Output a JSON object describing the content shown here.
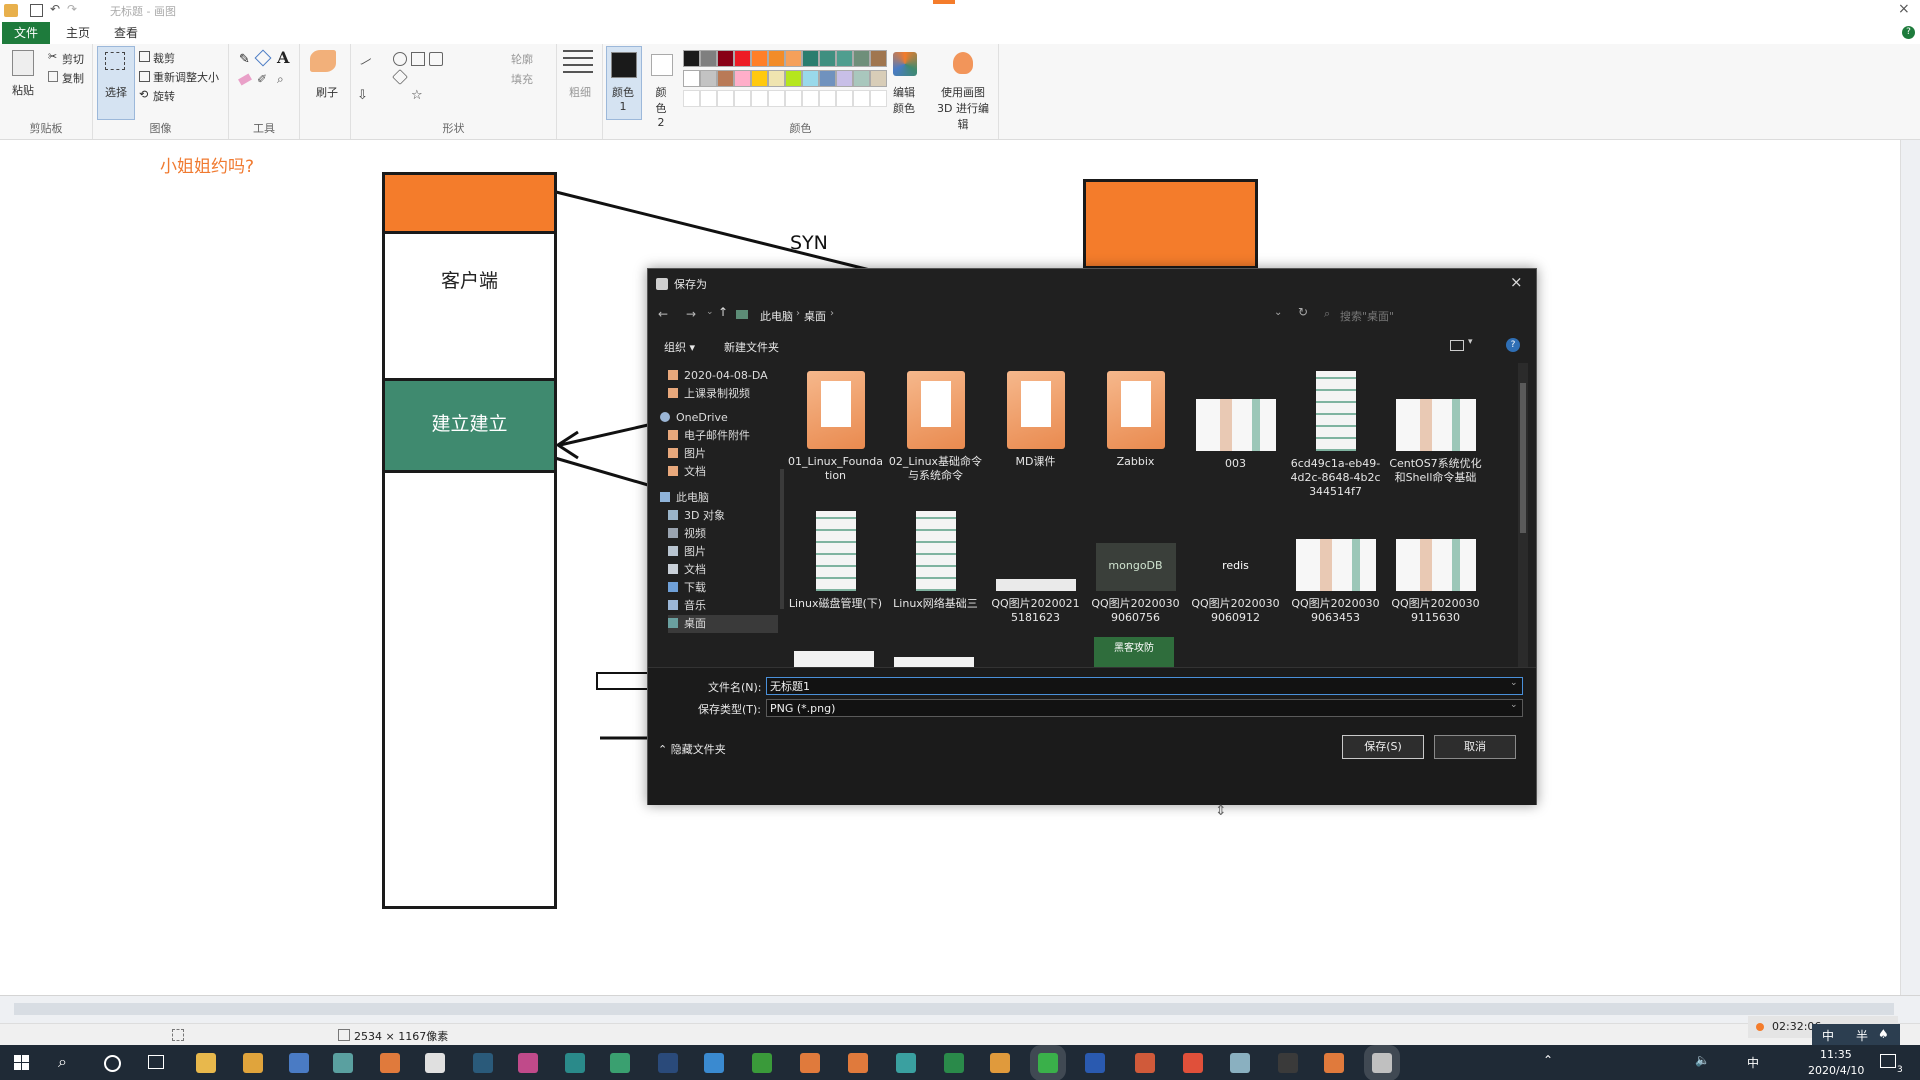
{
  "app": {
    "title_text": "无标题 - 画图",
    "tabs": [
      "文件",
      "主页",
      "查看"
    ]
  },
  "ribbon": {
    "clipboard": {
      "paste": "粘贴",
      "cut": "剪切",
      "copy": "复制",
      "label": "剪贴板"
    },
    "image": {
      "select": "选择",
      "crop": "裁剪",
      "resize": "重新调整大小",
      "rotate": "旋转",
      "label": "图像"
    },
    "tools": {
      "text_glyph": "A",
      "label": "工具"
    },
    "brushes": {
      "label": "刷子"
    },
    "shapes": {
      "outline": "轮廓",
      "fill": "填充",
      "label": "形状"
    },
    "size": {
      "label": "粗细"
    },
    "colors": {
      "color1": "颜色 1",
      "color2": "颜色 2",
      "edit_colors": "编辑颜色",
      "paint3d": "使用画图 3D 进行编辑",
      "label": "颜色",
      "palette_row1": [
        "#1a1a1a",
        "#7f7f7f",
        "#880015",
        "#ed1c24",
        "#ff7f27",
        "#f28c28",
        "#f5a05a",
        "#2a7d6e",
        "#3f8f80",
        "#4f9e8f",
        "#6f8f7a",
        "#a0764f"
      ],
      "palette_row2": [
        "#ffffff",
        "#c3c3c3",
        "#b97a57",
        "#ffaec9",
        "#ffc90e",
        "#efe4b0",
        "#b5e61d",
        "#99d9ea",
        "#7092be",
        "#c8bfe7",
        "#a9c7bd",
        "#d8cdb8"
      ]
    }
  },
  "canvas": {
    "question": "小姐姐约吗?",
    "client_label": "客户端",
    "established_label": "建立建立",
    "syn_label": "SYN",
    "colors": {
      "orange": "#f47c2b",
      "teal": "#3f8a6f",
      "question": "#f07a30"
    }
  },
  "status": {
    "dimensions": "2534 × 1167像素"
  },
  "dialog": {
    "title": "保存为",
    "breadcrumb": [
      "此电脑",
      "桌面"
    ],
    "search_placeholder": "搜索\"桌面\"",
    "organize": "组织",
    "new_folder": "新建文件夹",
    "tree": [
      {
        "label": "2020-04-08-DA",
        "icon": "folder-icon"
      },
      {
        "label": "上课录制视频",
        "icon": "folder-icon"
      },
      {
        "label": "OneDrive",
        "icon": "cloud-icon"
      },
      {
        "label": "电子邮件附件",
        "icon": "folder-icon"
      },
      {
        "label": "图片",
        "icon": "folder-icon"
      },
      {
        "label": "文档",
        "icon": "folder-icon"
      },
      {
        "label": "此电脑",
        "icon": "computer-icon"
      },
      {
        "label": "3D 对象",
        "icon": "cube-icon"
      },
      {
        "label": "视频",
        "icon": "video-icon"
      },
      {
        "label": "图片",
        "icon": "pictures-icon"
      },
      {
        "label": "文档",
        "icon": "documents-icon"
      },
      {
        "label": "下载",
        "icon": "download-icon"
      },
      {
        "label": "音乐",
        "icon": "music-icon"
      },
      {
        "label": "桌面",
        "icon": "desktop-icon"
      }
    ],
    "files": [
      {
        "name": "01_Linux_Foundation",
        "kind": "folder"
      },
      {
        "name": "02_Linux基础命令与系统命令",
        "kind": "folder"
      },
      {
        "name": "MD课件",
        "kind": "folder"
      },
      {
        "name": "Zabbix",
        "kind": "folder"
      },
      {
        "name": "003",
        "kind": "image"
      },
      {
        "name": "6cd49c1a-eb49-4d2c-8648-4b2c344514f7",
        "kind": "tall-image"
      },
      {
        "name": "CentOS7系统优化和Shell命令基础",
        "kind": "image"
      },
      {
        "name": "Linux磁盘管理(下)",
        "kind": "tall-image"
      },
      {
        "name": "Linux网络基础三",
        "kind": "tall-image"
      },
      {
        "name": "QQ图片20200215181623",
        "kind": "strip"
      },
      {
        "name": "QQ图片20200309060756",
        "kind": "mongodb"
      },
      {
        "name": "QQ图片20200309060912",
        "kind": "redis"
      },
      {
        "name": "QQ图片20200309063453",
        "kind": "image"
      },
      {
        "name": "QQ图片20200309115630",
        "kind": "image"
      }
    ],
    "mongodb_label": "mongoDB",
    "redis_label": "redis",
    "partial_label": "黑客攻防",
    "filename_label": "文件名(N):",
    "filename_value": "无标题1",
    "filetype_label": "保存类型(T):",
    "filetype_value": "PNG (*.png)",
    "hide_folders": "隐藏文件夹",
    "save": "保存(S)",
    "cancel": "取消"
  },
  "taskbar": {
    "clock_time": "11:35",
    "clock_date": "2020/4/10",
    "rec_time": "02:32:06",
    "ime": "中",
    "ime_mode": "半",
    "notif_count": "3"
  }
}
